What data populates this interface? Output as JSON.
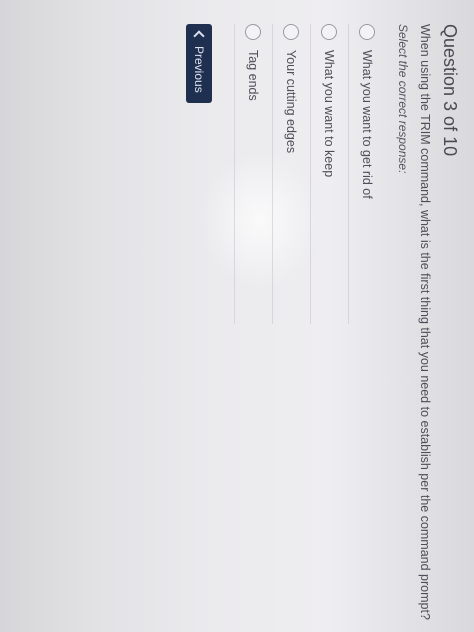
{
  "quiz": {
    "header": "Question 3 of 10",
    "question": "When using the TRIM command, what is the first thing that you need to establish per the command prompt?",
    "instruction": "Select the correct response:",
    "options": [
      {
        "label": "What you want to get rid of"
      },
      {
        "label": "What you want to keep"
      },
      {
        "label": "Your cutting edges"
      },
      {
        "label": "Tag ends"
      }
    ],
    "previous_label": "Previous"
  },
  "colors": {
    "primary_button": "#1f2f4f",
    "background": "#ebeaed"
  }
}
